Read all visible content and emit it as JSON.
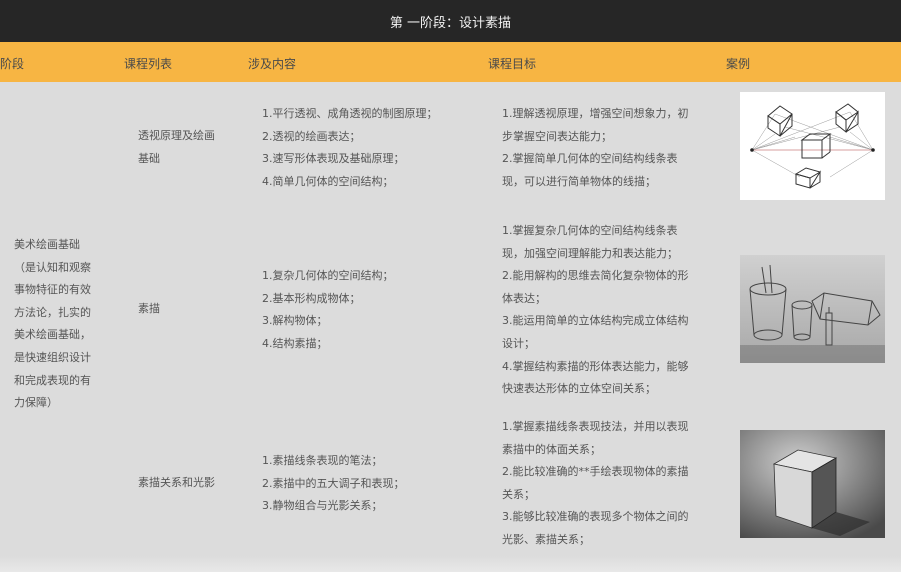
{
  "title": "第 一阶段：设计素描",
  "headers": {
    "stage": "阶段",
    "course": "课程列表",
    "content": "涉及内容",
    "goal": "课程目标",
    "case": "案例"
  },
  "stage": {
    "lines": [
      "美术绘画基础",
      "（是认知和观察",
      "事物特征的有效",
      "方法论，扎实的",
      "美术绘画基础，",
      "是快速组织设计",
      "和完成表现的有",
      "力保障）"
    ]
  },
  "rows": [
    {
      "course": [
        "透视原理及绘画",
        "基础"
      ],
      "content": [
        "1.平行透视、成角透视的制图原理；",
        "2.透视的绘画表达；",
        "3.速写形体表现及基础原理；",
        "4.简单几何体的空间结构；"
      ],
      "goal": [
        "1.理解透视原理，增强空间想象力，初",
        "步掌握空间表达能力；",
        "2.掌握简单几何体的空间结构线条表",
        "现，可以进行简单物体的线描；"
      ],
      "case_icon": "perspective-sketch-icon"
    },
    {
      "course": [
        "素描"
      ],
      "content": [
        "1.复杂几何体的空间结构；",
        "2.基本形构成物体；",
        "3.解构物体；",
        "4.结构素描；"
      ],
      "goal": [
        "1.掌握复杂几何体的空间结构线条表",
        "现，加强空间理解能力和表达能力；",
        "2.能用解构的思维去简化复杂物体的形",
        "体表达；",
        "3.能运用简单的立体结构完成立体结构",
        "设计；",
        "4.掌握结构素描的形体表达能力，能够",
        "快速表达形体的立体空间关系；"
      ],
      "case_icon": "still-life-sketch-icon"
    },
    {
      "course": [
        "素描关系和光影"
      ],
      "content": [
        "1.素描线条表现的笔法；",
        "2.素描中的五大调子和表现；",
        "3.静物组合与光影关系；"
      ],
      "goal": [
        "1.掌握素描线条表现技法，并用以表现",
        "素描中的体面关系；",
        "2.能比较准确的**手绘表现物体的素描",
        "关系；",
        "3.能够比较准确的表现多个物体之间的",
        "光影、素描关系；"
      ],
      "case_icon": "shaded-cube-icon"
    }
  ]
}
